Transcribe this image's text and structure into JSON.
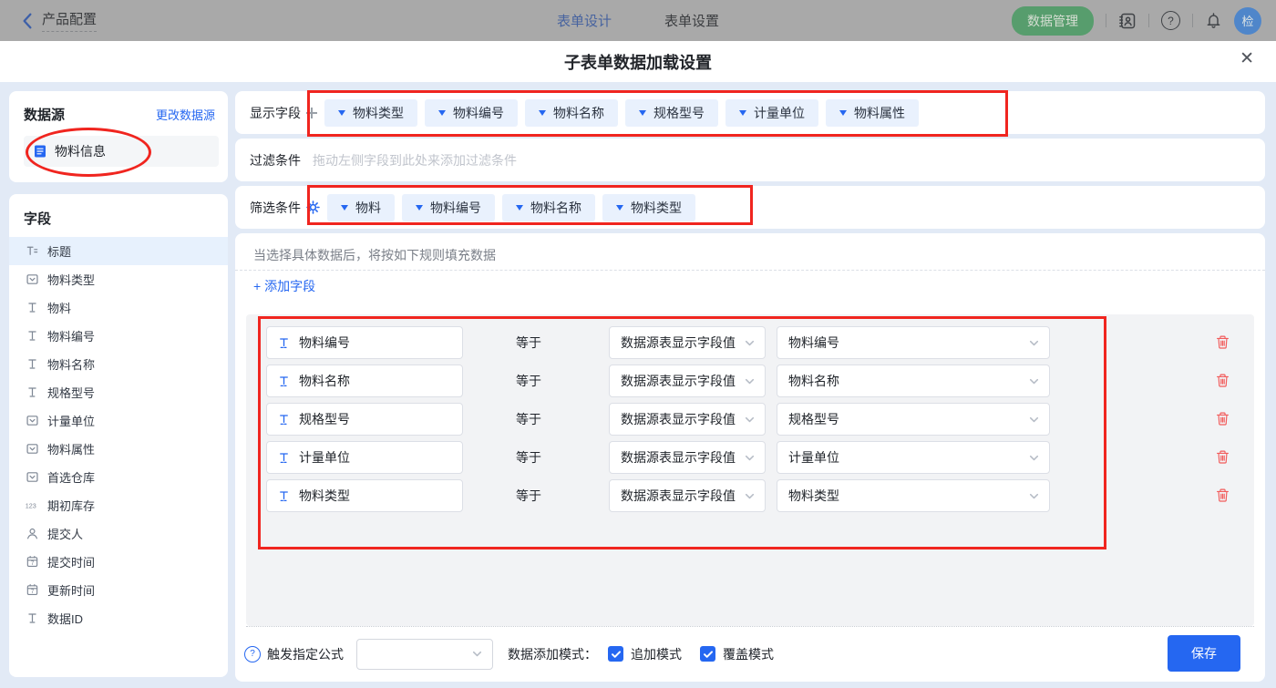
{
  "topbar": {
    "back": "产品配置",
    "tabs": [
      {
        "label": "表单设计",
        "active": true
      },
      {
        "label": "表单设置",
        "active": false
      }
    ],
    "data_manage": "数据管理",
    "avatar": "检"
  },
  "icons": {
    "close": "✕",
    "help": "?"
  },
  "modal": {
    "title": "子表单数据加载设置"
  },
  "datasource": {
    "title": "数据源",
    "change_link": "更改数据源",
    "item": "物料信息"
  },
  "fields": {
    "title": "字段",
    "items": [
      {
        "label": "标题",
        "icon": "title",
        "selected": true
      },
      {
        "label": "物料类型",
        "icon": "select"
      },
      {
        "label": "物料",
        "icon": "text"
      },
      {
        "label": "物料编号",
        "icon": "text"
      },
      {
        "label": "物料名称",
        "icon": "text"
      },
      {
        "label": "规格型号",
        "icon": "text"
      },
      {
        "label": "计量单位",
        "icon": "select"
      },
      {
        "label": "物料属性",
        "icon": "select"
      },
      {
        "label": "首选仓库",
        "icon": "select"
      },
      {
        "label": "期初库存",
        "icon": "number"
      },
      {
        "label": "提交人",
        "icon": "user"
      },
      {
        "label": "提交时间",
        "icon": "date"
      },
      {
        "label": "更新时间",
        "icon": "date"
      },
      {
        "label": "数据ID",
        "icon": "text"
      }
    ]
  },
  "display_fields": {
    "label": "显示字段",
    "tags": [
      "物料类型",
      "物料编号",
      "物料名称",
      "规格型号",
      "计量单位",
      "物料属性"
    ]
  },
  "filter": {
    "label": "过滤条件",
    "placeholder": "拖动左侧字段到此处来添加过滤条件"
  },
  "screen": {
    "label": "筛选条件",
    "tags": [
      "物料",
      "物料编号",
      "物料名称",
      "物料类型"
    ]
  },
  "rules": {
    "hint": "当选择具体数据后，将按如下规则填充数据",
    "add_field": "+ 添加字段",
    "equals": "等于",
    "source_option": "数据源表显示字段值",
    "rows": [
      {
        "field": "物料编号",
        "value": "物料编号"
      },
      {
        "field": "物料名称",
        "value": "物料名称"
      },
      {
        "field": "规格型号",
        "value": "规格型号"
      },
      {
        "field": "计量单位",
        "value": "计量单位"
      },
      {
        "field": "物料类型",
        "value": "物料类型"
      }
    ]
  },
  "footer": {
    "formula_label": "触发指定公式",
    "mode_label": "数据添加模式：",
    "modes": [
      {
        "label": "追加模式",
        "checked": true
      },
      {
        "label": "覆盖模式",
        "checked": true
      }
    ],
    "save": "保存"
  },
  "colors": {
    "primary": "#2567f1",
    "annotation": "#f0251f",
    "topbar_green": "#579d6d"
  }
}
